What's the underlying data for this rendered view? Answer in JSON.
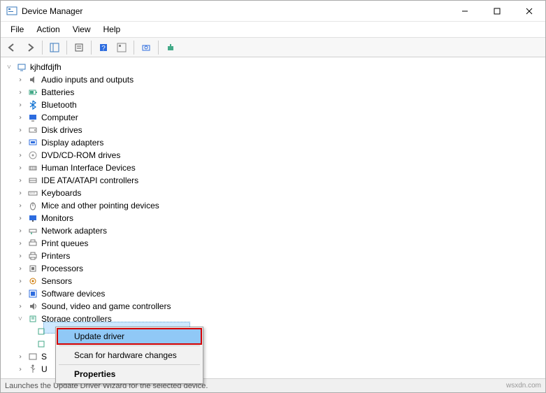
{
  "window": {
    "title": "Device Manager"
  },
  "menu": {
    "file": "File",
    "action": "Action",
    "view": "View",
    "help": "Help"
  },
  "toolbar_icons": [
    "back",
    "forward",
    "sep",
    "show-hide-tree",
    "sep",
    "properties",
    "sep",
    "help",
    "options",
    "sep",
    "scan-hardware",
    "sep",
    "add-legacy"
  ],
  "tree": {
    "root": "kjhdfdjfh",
    "items": [
      {
        "label": "Audio inputs and outputs",
        "icon": "audio"
      },
      {
        "label": "Batteries",
        "icon": "battery"
      },
      {
        "label": "Bluetooth",
        "icon": "bluetooth"
      },
      {
        "label": "Computer",
        "icon": "computer"
      },
      {
        "label": "Disk drives",
        "icon": "disk"
      },
      {
        "label": "Display adapters",
        "icon": "display"
      },
      {
        "label": "DVD/CD-ROM drives",
        "icon": "cd"
      },
      {
        "label": "Human Interface Devices",
        "icon": "hid"
      },
      {
        "label": "IDE ATA/ATAPI controllers",
        "icon": "ide"
      },
      {
        "label": "Keyboards",
        "icon": "keyboard"
      },
      {
        "label": "Mice and other pointing devices",
        "icon": "mouse"
      },
      {
        "label": "Monitors",
        "icon": "monitor"
      },
      {
        "label": "Network adapters",
        "icon": "network"
      },
      {
        "label": "Print queues",
        "icon": "printq"
      },
      {
        "label": "Printers",
        "icon": "printer"
      },
      {
        "label": "Processors",
        "icon": "cpu"
      },
      {
        "label": "Sensors",
        "icon": "sensor"
      },
      {
        "label": "Software devices",
        "icon": "software"
      },
      {
        "label": "Sound, video and game controllers",
        "icon": "sound"
      },
      {
        "label": "Storage controllers",
        "icon": "storage",
        "expanded": true,
        "children": [
          {
            "label": "",
            "icon": "storage-child",
            "selected": true
          },
          {
            "label": "",
            "icon": "storage-child"
          }
        ]
      },
      {
        "label": "S",
        "icon": "system"
      },
      {
        "label": "U",
        "icon": "usb"
      }
    ]
  },
  "context_menu": {
    "update_driver": "Update driver",
    "scan": "Scan for hardware changes",
    "properties": "Properties"
  },
  "status": "Launches the Update Driver Wizard for the selected device.",
  "watermark": "wsxdn.com"
}
